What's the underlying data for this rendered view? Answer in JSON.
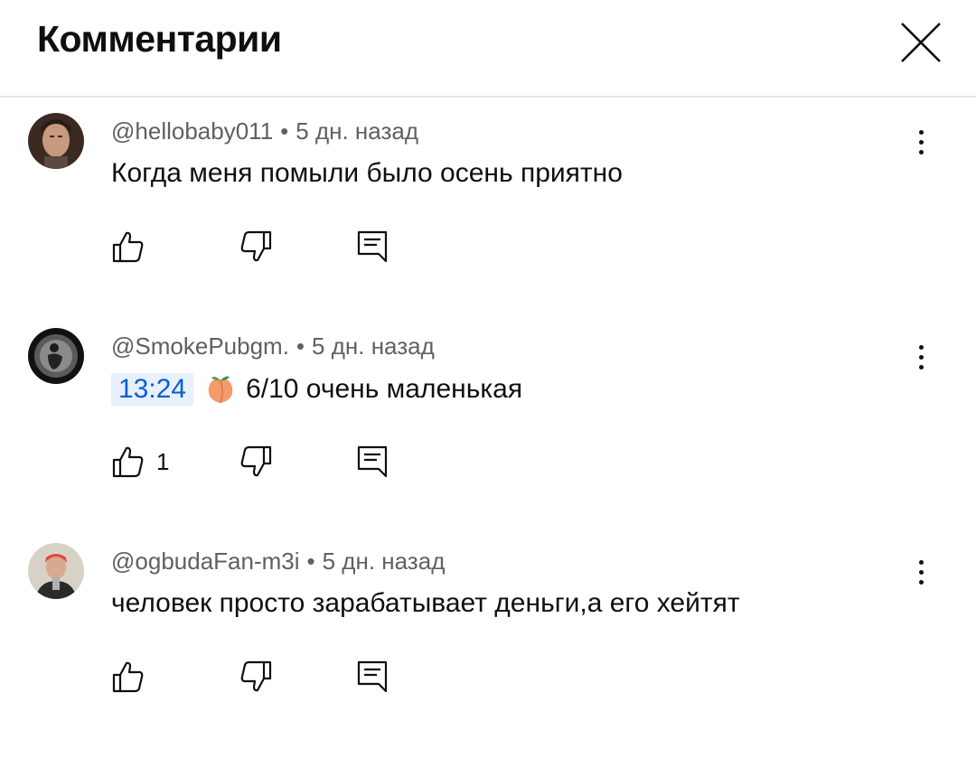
{
  "header": {
    "title": "Комментарии",
    "close_icon": "close-icon"
  },
  "comments": [
    {
      "author": "@hellobaby011",
      "separator": "•",
      "time": "5 дн. назад",
      "text": "Когда меня помыли было осень приятно",
      "likes": "",
      "avatar_color": "#6b4a3a"
    },
    {
      "author": "@SmokePubgm.",
      "separator": "•",
      "time": "5 дн. назад",
      "timestamp_link": "13:24",
      "emoji_icon": "peach-emoji-icon",
      "text": "6/10 очень маленькая",
      "likes": "1",
      "avatar_color": "#1a1a1a"
    },
    {
      "author": "@ogbudaFan-m3i",
      "separator": "•",
      "time": "5 дн. назад",
      "text": "человек просто зарабатывает деньги,а его хейтят",
      "likes": "",
      "avatar_color": "#c9c4ba"
    }
  ],
  "colors": {
    "text_primary": "#0f0f0f",
    "text_secondary": "#606060",
    "link": "#065fd4",
    "timestamp_bg": "#e8f0fe",
    "divider": "#e5e5e5"
  }
}
